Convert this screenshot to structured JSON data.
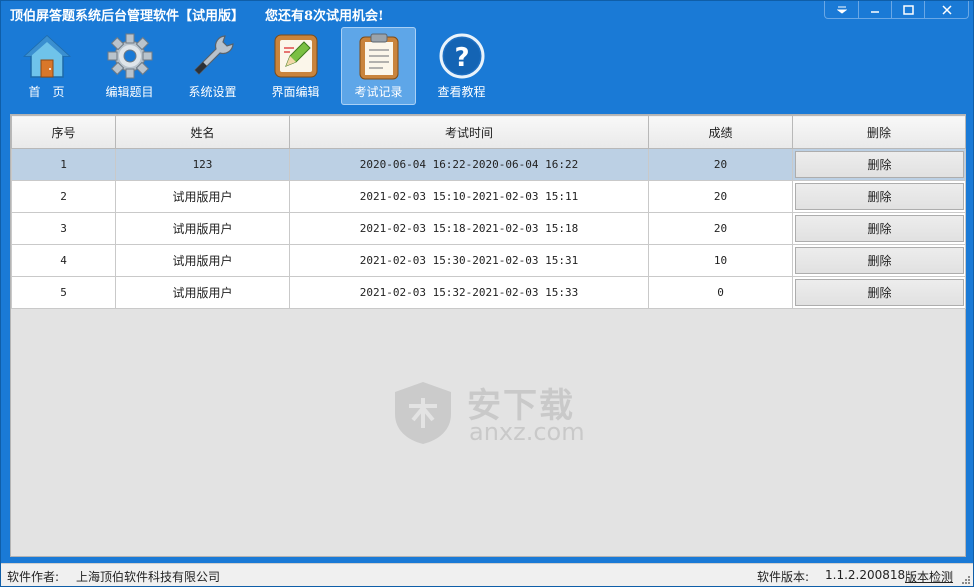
{
  "window": {
    "title": "顶伯屏答题系统后台管理软件【试用版】",
    "trial_notice": "您还有8次试用机会!",
    "controls": {
      "menu_icon": "dropdown-arrow-icon",
      "minimize_icon": "minimize-icon",
      "maximize_icon": "maximize-icon",
      "close_icon": "close-icon"
    }
  },
  "toolbar": {
    "items": [
      {
        "label": "首　页",
        "icon": "home-icon",
        "active": false
      },
      {
        "label": "编辑题目",
        "icon": "gear-icon",
        "active": false
      },
      {
        "label": "系统设置",
        "icon": "wrench-icon",
        "active": false
      },
      {
        "label": "界面编辑",
        "icon": "edit-board-icon",
        "active": false
      },
      {
        "label": "考试记录",
        "icon": "clipboard-icon",
        "active": true
      },
      {
        "label": "查看教程",
        "icon": "help-icon",
        "active": false
      }
    ]
  },
  "table": {
    "columns": [
      "序号",
      "姓名",
      "考试时间",
      "成绩",
      "删除"
    ],
    "rows": [
      {
        "no": "1",
        "name": "123",
        "time": "2020-06-04 16:22-2020-06-04 16:22",
        "score": "20",
        "action": "删除"
      },
      {
        "no": "2",
        "name": "试用版用户",
        "time": "2021-02-03 15:10-2021-02-03 15:11",
        "score": "20",
        "action": "删除"
      },
      {
        "no": "3",
        "name": "试用版用户",
        "time": "2021-02-03 15:18-2021-02-03 15:18",
        "score": "20",
        "action": "删除"
      },
      {
        "no": "4",
        "name": "试用版用户",
        "time": "2021-02-03 15:30-2021-02-03 15:31",
        "score": "10",
        "action": "删除"
      },
      {
        "no": "5",
        "name": "试用版用户",
        "time": "2021-02-03 15:32-2021-02-03 15:33",
        "score": "0",
        "action": "删除"
      }
    ],
    "selected_row": 0
  },
  "watermark": {
    "line1": "安下载",
    "line2": "anxz.com"
  },
  "statusbar": {
    "author_label": "软件作者:",
    "author_value": "上海顶伯软件科技有限公司",
    "version_label": "软件版本:",
    "version_value": "1.1.2.200818",
    "check_link": "版本检测"
  },
  "colors": {
    "frame": "#1a7ad6",
    "active_tool": "#5ea6e8",
    "selected_row": "#bcd0e4"
  }
}
